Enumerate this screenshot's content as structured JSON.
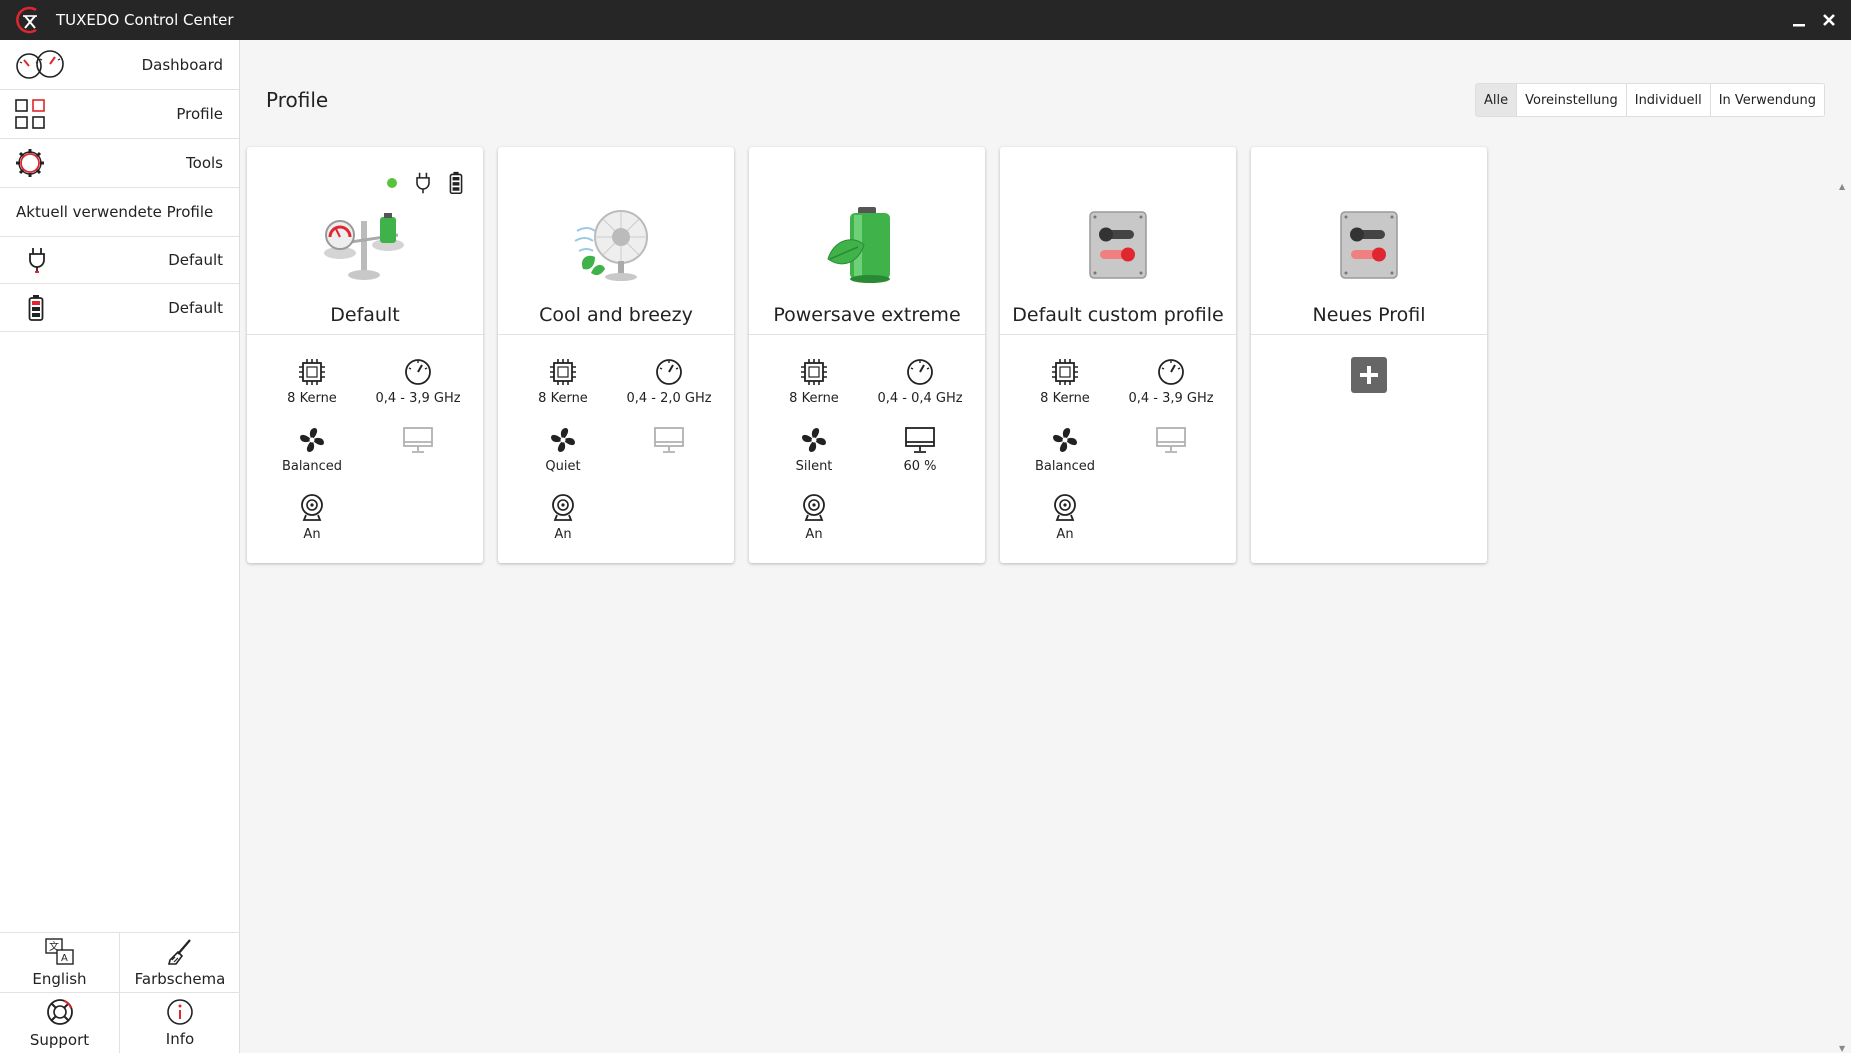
{
  "window": {
    "title": "TUXEDO Control Center"
  },
  "sidebar": {
    "nav": [
      {
        "label": "Dashboard",
        "icon": "dashboard-gauges-icon"
      },
      {
        "label": "Profile",
        "icon": "profiles-grid-icon"
      },
      {
        "label": "Tools",
        "icon": "gear-icon"
      }
    ],
    "active_section_title": "Aktuell verwendete Profile",
    "active_profiles": [
      {
        "label": "Default",
        "icon": "ac-plug-icon"
      },
      {
        "label": "Default",
        "icon": "battery-icon"
      }
    ],
    "bottom": [
      {
        "label": "English",
        "icon": "language-icon"
      },
      {
        "label": "Farbschema",
        "icon": "brush-icon"
      },
      {
        "label": "Support",
        "icon": "lifebuoy-icon"
      },
      {
        "label": "Info",
        "icon": "info-icon"
      }
    ]
  },
  "main": {
    "title": "Profile",
    "filters": [
      {
        "label": "Alle",
        "active": true
      },
      {
        "label": "Voreinstellung",
        "active": false
      },
      {
        "label": "Individuell",
        "active": false
      },
      {
        "label": "In Verwendung",
        "active": false
      }
    ],
    "cards": [
      {
        "name": "Default",
        "cores": "8 Kerne",
        "freq": "0,4 - 3,9 GHz",
        "fan": "Balanced",
        "display": "",
        "webcam": "An"
      },
      {
        "name": "Cool and breezy",
        "cores": "8 Kerne",
        "freq": "0,4 - 2,0 GHz",
        "fan": "Quiet",
        "display": "",
        "webcam": "An"
      },
      {
        "name": "Powersave extreme",
        "cores": "8 Kerne",
        "freq": "0,4 - 0,4 GHz",
        "fan": "Silent",
        "display": "60 %",
        "webcam": "An"
      },
      {
        "name": "Default custom profile",
        "cores": "8 Kerne",
        "freq": "0,4 - 3,9 GHz",
        "fan": "Balanced",
        "display": "",
        "webcam": "An"
      }
    ],
    "new_profile": {
      "name": "Neues Profil"
    }
  },
  "colors": {
    "accent": "#e0262f",
    "active_green": "#59c43a",
    "titlebar": "#262626"
  }
}
